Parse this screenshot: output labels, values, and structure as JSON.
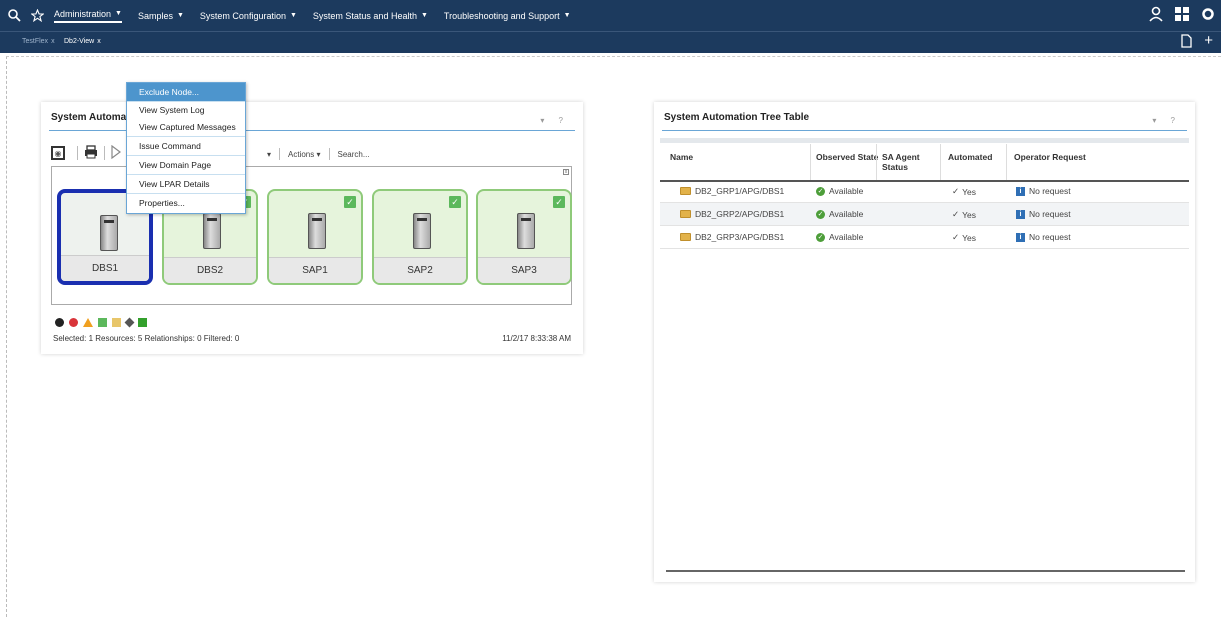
{
  "topnav": {
    "menu": [
      {
        "label": "Administration"
      },
      {
        "label": "Samples"
      },
      {
        "label": "System Configuration"
      },
      {
        "label": "System Status and Health"
      },
      {
        "label": "Troubleshooting and Support"
      }
    ]
  },
  "tabs": [
    {
      "label": "TestFlex",
      "close": "x"
    },
    {
      "label": "Db2-View",
      "close": "x"
    }
  ],
  "left_panel": {
    "title": "System Automati",
    "controls": "▾ ?",
    "toolbar": {
      "actions": "Actions",
      "actions_caret": "▾",
      "search": "Search..."
    },
    "nodes": [
      {
        "name": "DBS1",
        "selected": true
      },
      {
        "name": "DBS2"
      },
      {
        "name": "SAP1"
      },
      {
        "name": "SAP2"
      },
      {
        "name": "SAP3"
      }
    ],
    "status": "Selected: 1 Resources: 5 Relationships: 0 Filtered: 0",
    "timestamp": "11/2/17 8:33:38 AM"
  },
  "context_menu": {
    "items": [
      {
        "label": "Exclude Node..."
      },
      {
        "label": "View System Log"
      },
      {
        "label": "View Captured Messages"
      },
      {
        "label": "Issue Command"
      },
      {
        "label": "View Domain Page"
      },
      {
        "label": "View LPAR Details"
      },
      {
        "label": "Properties..."
      }
    ]
  },
  "right_panel": {
    "title": "System Automation Tree Table",
    "controls": "▾ ?",
    "columns": {
      "name": "Name",
      "observed": "Observed State",
      "agent": "SA Agent Status",
      "automated": "Automated",
      "request": "Operator Request"
    },
    "rows": [
      {
        "name": "DB2_GRP1/APG/DBS1",
        "observed": "Available",
        "automated": "Yes",
        "request": "No request"
      },
      {
        "name": "DB2_GRP2/APG/DBS1",
        "observed": "Available",
        "automated": "Yes",
        "request": "No request"
      },
      {
        "name": "DB2_GRP3/APG/DBS1",
        "observed": "Available",
        "automated": "Yes",
        "request": "No request"
      }
    ]
  },
  "colors": {
    "nav_bg": "#1c3a5e",
    "accent": "#4d95cd",
    "node_ok_border": "#8fca7a",
    "node_selected_border": "#1a2fb0"
  }
}
